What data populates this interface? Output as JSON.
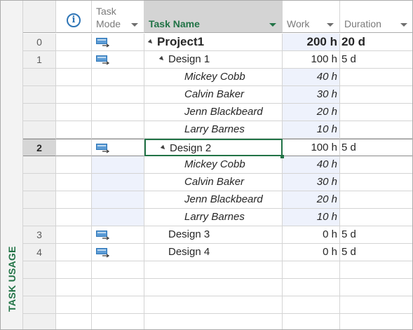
{
  "view": {
    "label": "TASK USAGE"
  },
  "columns": {
    "indicators_icon": "info-icon",
    "indicators_glyph": "i",
    "mode_line1": "Task",
    "mode_line2": "Mode",
    "name": "Task Name",
    "work": "Work",
    "duration": "Duration"
  },
  "rows": [
    {
      "id": "0",
      "name": "Project1",
      "work": "200 h",
      "duration": "20 d",
      "mode_icon": "auto-scheduled-task-icon"
    },
    {
      "id": "1",
      "name": "Design 1",
      "work": "100 h",
      "duration": "5 d",
      "mode_icon": "auto-scheduled-task-icon"
    },
    {
      "id": "",
      "name": "Mickey Cobb",
      "work": "40 h",
      "duration": ""
    },
    {
      "id": "",
      "name": "Calvin Baker",
      "work": "30 h",
      "duration": ""
    },
    {
      "id": "",
      "name": "Jenn Blackbeard",
      "work": "20 h",
      "duration": ""
    },
    {
      "id": "",
      "name": "Larry Barnes",
      "work": "10 h",
      "duration": ""
    },
    {
      "id": "2",
      "name": "Design 2",
      "work": "100 h",
      "duration": "5 d",
      "mode_icon": "auto-scheduled-task-icon"
    },
    {
      "id": "",
      "name": "Mickey Cobb",
      "work": "40 h",
      "duration": ""
    },
    {
      "id": "",
      "name": "Calvin Baker",
      "work": "30 h",
      "duration": ""
    },
    {
      "id": "",
      "name": "Jenn Blackbeard",
      "work": "20 h",
      "duration": ""
    },
    {
      "id": "",
      "name": "Larry Barnes",
      "work": "10 h",
      "duration": ""
    },
    {
      "id": "3",
      "name": "Design 3",
      "work": "0 h",
      "duration": "5 d",
      "mode_icon": "auto-scheduled-task-icon"
    },
    {
      "id": "4",
      "name": "Design 4",
      "work": "0 h",
      "duration": "5 d",
      "mode_icon": "auto-scheduled-task-icon"
    }
  ],
  "colors": {
    "accent": "#217346",
    "info": "#2e75b6",
    "shade": "#eef2fc"
  }
}
